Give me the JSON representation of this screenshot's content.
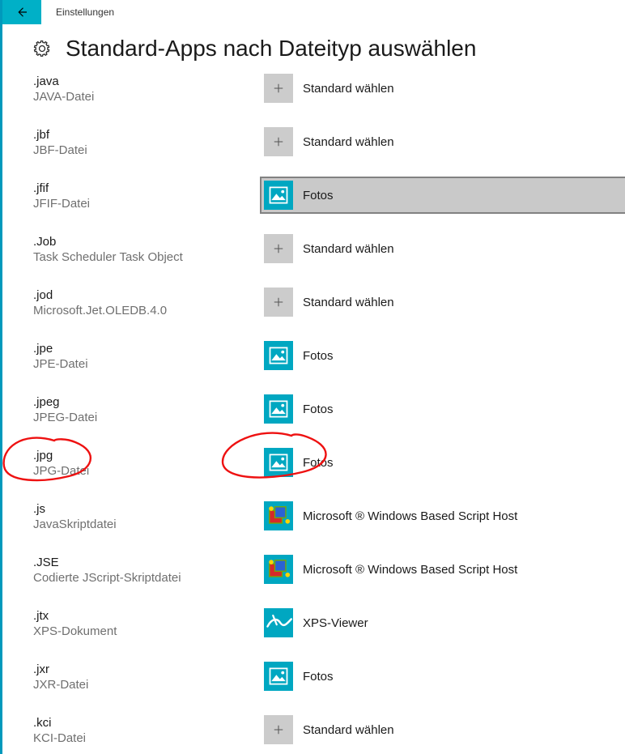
{
  "window": {
    "title": "Einstellungen"
  },
  "page": {
    "title": "Standard-Apps nach Dateityp auswählen"
  },
  "apps": {
    "choose": "Standard wählen",
    "fotos": "Fotos",
    "wsh": "Microsoft ® Windows Based Script Host",
    "xps": "XPS-Viewer"
  },
  "rows": [
    {
      "ext": ".java",
      "desc": "JAVA-Datei",
      "icon": "plus",
      "app_key": "choose"
    },
    {
      "ext": ".jbf",
      "desc": "JBF-Datei",
      "icon": "plus",
      "app_key": "choose"
    },
    {
      "ext": ".jfif",
      "desc": "JFIF-Datei",
      "icon": "fotos",
      "app_key": "fotos",
      "selected": true
    },
    {
      "ext": ".Job",
      "desc": "Task Scheduler Task Object",
      "icon": "plus",
      "app_key": "choose"
    },
    {
      "ext": ".jod",
      "desc": "Microsoft.Jet.OLEDB.4.0",
      "icon": "plus",
      "app_key": "choose"
    },
    {
      "ext": ".jpe",
      "desc": "JPE-Datei",
      "icon": "fotos",
      "app_key": "fotos"
    },
    {
      "ext": ".jpeg",
      "desc": "JPEG-Datei",
      "icon": "fotos",
      "app_key": "fotos"
    },
    {
      "ext": ".jpg",
      "desc": "JPG-Datei",
      "icon": "fotos",
      "app_key": "fotos"
    },
    {
      "ext": ".js",
      "desc": "JavaSkriptdatei",
      "icon": "script",
      "app_key": "wsh"
    },
    {
      "ext": ".JSE",
      "desc": "Codierte JScript-Skriptdatei",
      "icon": "script",
      "app_key": "wsh"
    },
    {
      "ext": ".jtx",
      "desc": "XPS-Dokument",
      "icon": "xps",
      "app_key": "xps"
    },
    {
      "ext": ".jxr",
      "desc": "JXR-Datei",
      "icon": "fotos",
      "app_key": "fotos"
    },
    {
      "ext": ".kci",
      "desc": "KCI-Datei",
      "icon": "plus",
      "app_key": "choose"
    }
  ],
  "annotations": [
    {
      "target_ext": ".jpg",
      "which": "left"
    },
    {
      "target_ext": ".jpg",
      "which": "right"
    }
  ],
  "colors": {
    "accent": "#00b0c7",
    "annotation": "#e11"
  }
}
